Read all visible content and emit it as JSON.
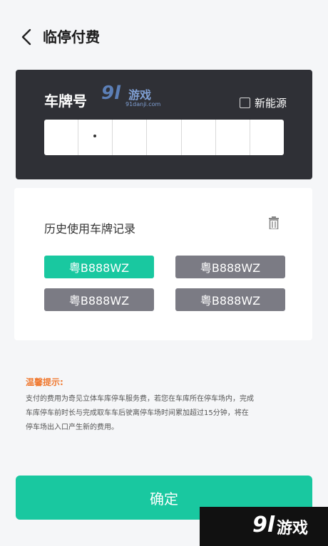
{
  "header": {
    "title": "临停付费"
  },
  "plate": {
    "label": "车牌号",
    "new_energy_label": "新能源",
    "cells": [
      "",
      "",
      "",
      "",
      "",
      "",
      ""
    ]
  },
  "history": {
    "title": "历史使用车牌记录",
    "plates": [
      "粤B888WZ",
      "粤B888WZ",
      "粤B888WZ",
      "粤B888WZ"
    ]
  },
  "tips": {
    "title": "温馨提示:",
    "line1": "支付的费用为奇见立体车库停车服务费，若您在车库所在停车场内，完成",
    "line2": "车库停车前时长与完成取车车后驶离停车场时间累加超过15分钟，将在",
    "line3": "停车场出入口产生新的费用。"
  },
  "confirm_label": "确定",
  "watermarks": {
    "top_logo": "9l",
    "top_text": "游戏",
    "top_url": "91danji.com",
    "bottom_logo": "9l",
    "bottom_text": "游戏"
  },
  "colors": {
    "accent": "#19c8a0",
    "dark_card": "#2f3036",
    "chip_gray": "#7b7b84",
    "tips_title": "#f07a32"
  }
}
